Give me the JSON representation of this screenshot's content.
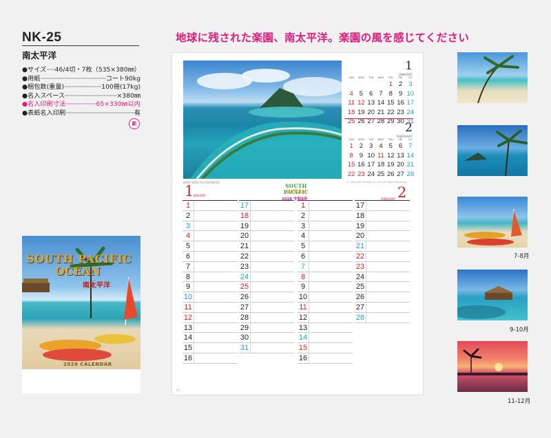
{
  "product": {
    "model": "NK-25",
    "name": "南太平洋"
  },
  "specs": [
    {
      "label": "●サイズ",
      "value": "46/4切・7枚（535×380㎜）",
      "highlight": false
    },
    {
      "label": "●用紙",
      "value": "コート90kg",
      "highlight": false
    },
    {
      "label": "●梱包数(重量)",
      "value": "100冊(17kg)",
      "highlight": false
    },
    {
      "label": "●名入スペース",
      "value": "×380㎜",
      "highlight": false
    },
    {
      "label": "●名入印刷寸法",
      "value": "65×330㎜以内",
      "highlight": true
    },
    {
      "label": "●表紙名入印刷",
      "value": "有",
      "highlight": false
    }
  ],
  "badge": "新",
  "cover": {
    "title_line1": "SOUTH PACIFIC",
    "title_line2": "OCEAN",
    "title_jp": "南太平洋",
    "calendar_label": "2026 CALENDAR"
  },
  "headline": "地球に残された楽園、南太平洋。楽園の風を感じてください",
  "calendar": {
    "brand_line1": "SOUTH PACIFIC",
    "brand_line2": "OCEAN",
    "year_label": "2026 令和8年",
    "caption_left": "BORA BORA FR.POLYNESIA",
    "caption_right": "© Copyright Printing Co., Ltd. All Rights Reserved.",
    "page_no": "27",
    "dow": [
      "SUN",
      "MON",
      "TUE",
      "WED",
      "THU",
      "FRI",
      "SAT"
    ],
    "mini": [
      {
        "num": "1",
        "name": "JANUARY",
        "weeks": [
          [
            "",
            "",
            "",
            "",
            "1",
            "2",
            "3"
          ],
          [
            "4",
            "5",
            "6",
            "7",
            "8",
            "9",
            "10"
          ],
          [
            "11",
            "12",
            "13",
            "14",
            "15",
            "16",
            "17"
          ],
          [
            "18",
            "19",
            "20",
            "21",
            "22",
            "23",
            "24"
          ],
          [
            "25",
            "26",
            "27",
            "28",
            "29",
            "30",
            "31"
          ]
        ],
        "red": [
          "1",
          "4",
          "11",
          "12",
          "18",
          "25"
        ],
        "blue": [
          "3",
          "10",
          "17",
          "24",
          "31"
        ]
      },
      {
        "num": "2",
        "name": "FEBRUARY",
        "weeks": [
          [
            "1",
            "2",
            "3",
            "4",
            "5",
            "6",
            "7"
          ],
          [
            "8",
            "9",
            "10",
            "11",
            "12",
            "13",
            "14"
          ],
          [
            "15",
            "16",
            "17",
            "18",
            "19",
            "20",
            "21"
          ],
          [
            "22",
            "23",
            "24",
            "25",
            "26",
            "27",
            "28"
          ]
        ],
        "red": [
          "1",
          "8",
          "11",
          "15",
          "22",
          "23"
        ],
        "blue": [
          "7",
          "14",
          "21",
          "28"
        ]
      }
    ],
    "daily": {
      "jan_num": "1",
      "jan_name": "JANUARY",
      "feb_num": "2",
      "feb_name": "FEBRUARY",
      "jan_a": [
        [
          "1",
          "red"
        ],
        [
          "2",
          ""
        ],
        [
          "3",
          "blue"
        ],
        [
          "4",
          "red"
        ],
        [
          "5",
          ""
        ],
        [
          "6",
          ""
        ],
        [
          "7",
          ""
        ],
        [
          "8",
          ""
        ],
        [
          "9",
          ""
        ],
        [
          "10",
          "blue"
        ],
        [
          "11",
          "red"
        ],
        [
          "12",
          "red"
        ],
        [
          "13",
          ""
        ],
        [
          "14",
          ""
        ],
        [
          "15",
          ""
        ],
        [
          "16",
          ""
        ]
      ],
      "jan_b": [
        [
          "17",
          "blue"
        ],
        [
          "18",
          "red"
        ],
        [
          "19",
          ""
        ],
        [
          "20",
          ""
        ],
        [
          "21",
          ""
        ],
        [
          "22",
          ""
        ],
        [
          "23",
          ""
        ],
        [
          "24",
          "blue"
        ],
        [
          "25",
          "red"
        ],
        [
          "26",
          ""
        ],
        [
          "27",
          ""
        ],
        [
          "28",
          ""
        ],
        [
          "29",
          ""
        ],
        [
          "30",
          ""
        ],
        [
          "31",
          "blue"
        ]
      ],
      "feb_a": [
        [
          "1",
          "red"
        ],
        [
          "2",
          ""
        ],
        [
          "3",
          ""
        ],
        [
          "4",
          ""
        ],
        [
          "5",
          ""
        ],
        [
          "6",
          ""
        ],
        [
          "7",
          "blue"
        ],
        [
          "8",
          "red"
        ],
        [
          "9",
          ""
        ],
        [
          "10",
          ""
        ],
        [
          "11",
          "red"
        ],
        [
          "12",
          ""
        ],
        [
          "13",
          ""
        ],
        [
          "14",
          "blue"
        ],
        [
          "15",
          "red"
        ],
        [
          "16",
          ""
        ]
      ],
      "feb_b": [
        [
          "17",
          ""
        ],
        [
          "18",
          ""
        ],
        [
          "19",
          ""
        ],
        [
          "20",
          ""
        ],
        [
          "21",
          "blue"
        ],
        [
          "22",
          "red"
        ],
        [
          "23",
          "red"
        ],
        [
          "24",
          ""
        ],
        [
          "25",
          ""
        ],
        [
          "26",
          ""
        ],
        [
          "27",
          ""
        ],
        [
          "28",
          "blue"
        ]
      ]
    }
  },
  "thumbnails": [
    {
      "label": ""
    },
    {
      "label": ""
    },
    {
      "label": "7-8月"
    },
    {
      "label": "9-10月"
    },
    {
      "label": "11-12月"
    }
  ]
}
